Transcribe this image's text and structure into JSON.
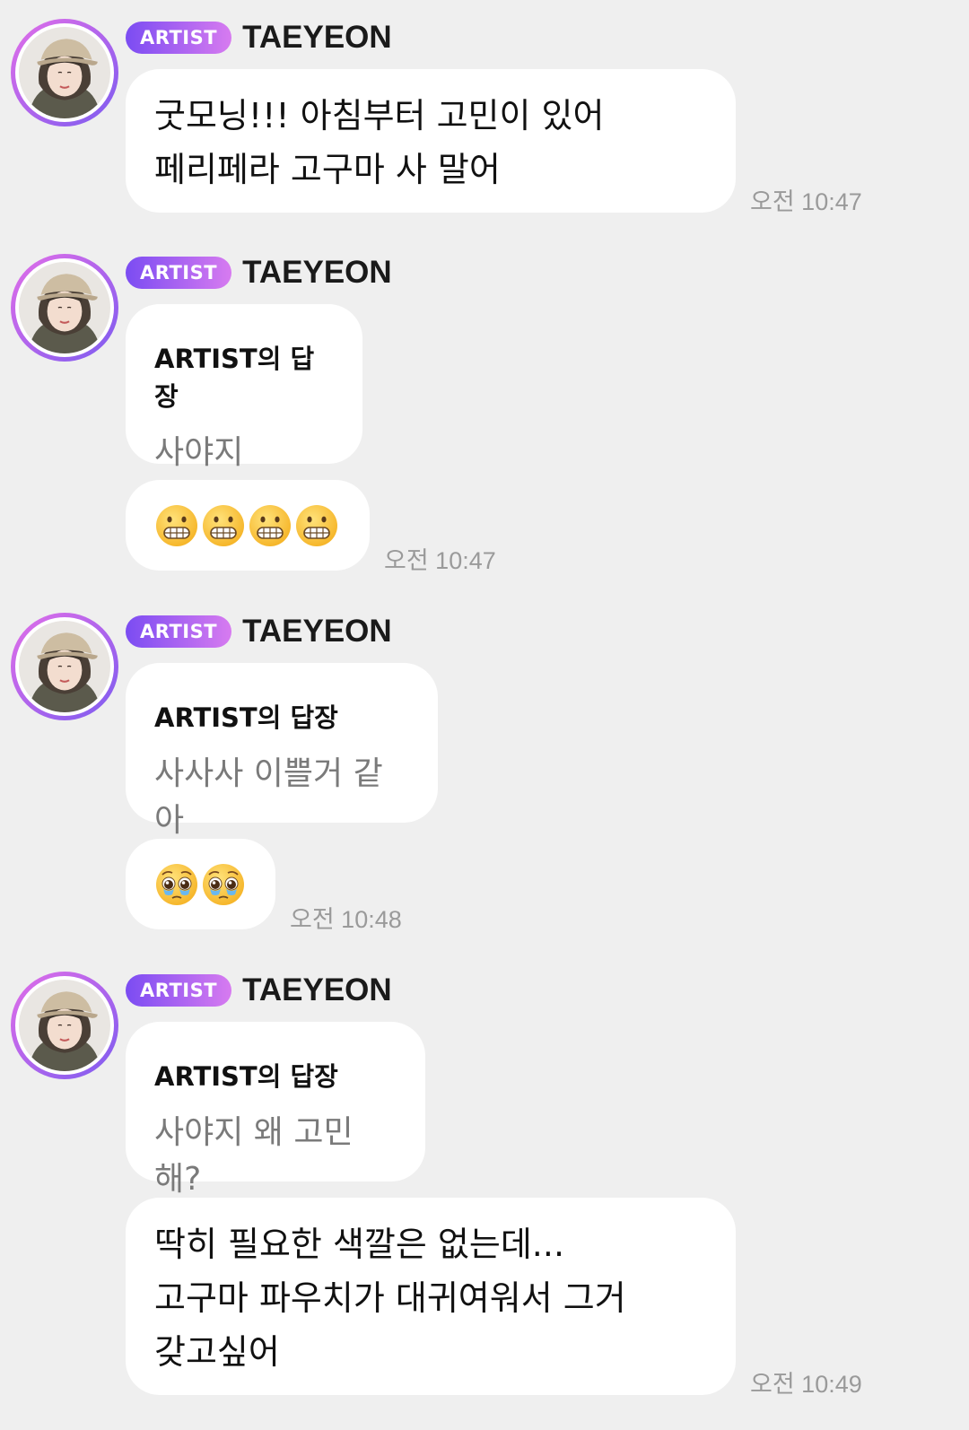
{
  "sender": {
    "badge": "ARTIST",
    "name": "TAEYEON"
  },
  "reply_title": "ARTIST의 답장",
  "messages": {
    "m1": {
      "text": "굿모닝!!! 아침부터 고민이 있어\n페리페라 고구마 사 말어",
      "time": "오전 10:47"
    },
    "m2": {
      "reply": "사야지",
      "emoji_name": "grimacing-face-icon",
      "emoji_count": 4,
      "time": "오전 10:47"
    },
    "m3": {
      "reply": "사사사 이쁠거 같아",
      "emoji_name": "pleading-face-icon",
      "emoji_count": 2,
      "time": "오전 10:48"
    },
    "m4": {
      "reply": "사야지 왜 고민해?",
      "text": "딱히 필요한 색깔은 없는데...\n고구마 파우치가 대귀여워서 그거\n갖고싶어",
      "time": "오전 10:49"
    }
  },
  "colors": {
    "badge_start": "#7b4cf2",
    "badge_end": "#d77bf0",
    "background": "#efefef",
    "bubble": "#ffffff"
  }
}
